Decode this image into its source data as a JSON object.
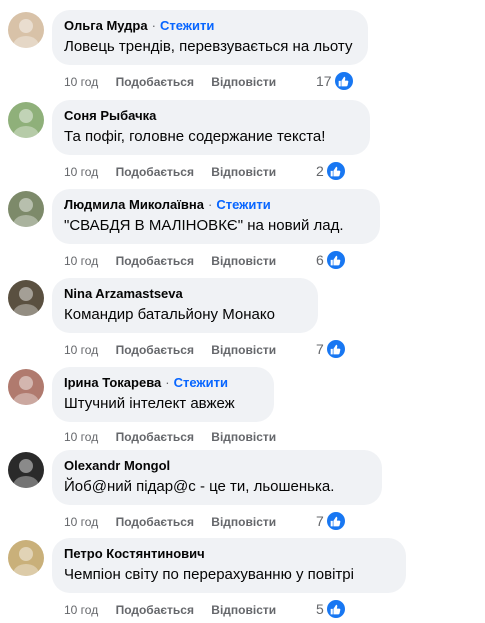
{
  "comments": [
    {
      "author": "Ольга Мудра",
      "follow": "Стежити",
      "text": "Ловець трендів, перевзувається на льоту",
      "time": "10 год",
      "like": "Подобається",
      "reply": "Відповісти",
      "reactions": "17",
      "avatar_color": "#d8c2a8"
    },
    {
      "author": "Соня Рыбачка",
      "follow": "",
      "text": "Та пофіг, головне содержание текста!",
      "time": "10 год",
      "like": "Подобається",
      "reply": "Відповісти",
      "reactions": "2",
      "avatar_color": "#8fb07a"
    },
    {
      "author": "Людмила Миколаївна",
      "follow": "Стежити",
      "text": "\"СВАБДЯ В МАЛІНОВКЄ\" на новий лад.",
      "time": "10 год",
      "like": "Подобається",
      "reply": "Відповісти",
      "reactions": "6",
      "avatar_color": "#7d8a6a"
    },
    {
      "author": "Nina Arzamastseva",
      "follow": "",
      "text": "Командир батальйону Монако",
      "time": "10 год",
      "like": "Подобається",
      "reply": "Відповісти",
      "reactions": "7",
      "avatar_color": "#5a5040"
    },
    {
      "author": "Ірина Токарева",
      "follow": "Стежити",
      "text": "Штучний інтелект авжеж",
      "time": "10 год",
      "like": "Подобається",
      "reply": "Відповісти",
      "reactions": "",
      "avatar_color": "#b07a6e"
    },
    {
      "author": "Olexandr Mongol",
      "follow": "",
      "text": "Йоб@ний підар@с - це ти, льошенька.",
      "time": "10 год",
      "like": "Подобається",
      "reply": "Відповісти",
      "reactions": "7",
      "avatar_color": "#2a2a2a"
    },
    {
      "author": "Петро Костянтинович",
      "follow": "",
      "text": "Чемпіон світу по перерахуванню у повітрі",
      "time": "10 год",
      "like": "Подобається",
      "reply": "Відповісти",
      "reactions": "5",
      "avatar_color": "#c9b07a"
    }
  ],
  "separator": "·",
  "icons": {
    "like": "thumbs-up-icon"
  },
  "accent": "#0866ff",
  "like_badge_color": "#1877f2"
}
